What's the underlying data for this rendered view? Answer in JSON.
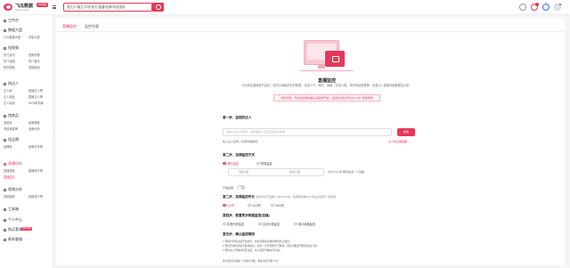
{
  "header": {
    "brand": "飞瓜数据",
    "brand_badge": "抖音版",
    "brand_sub": "FEIGUA DATA",
    "search_placeholder": "搜达人/播主/抖号/宝贝/直播/品牌/商品搜索",
    "icons": [
      "search-icon",
      "app-icon",
      "message-icon",
      "vip-icon",
      "avatar"
    ]
  },
  "sidebar": {
    "items": [
      {
        "label": "工作台",
        "icon": "home-icon"
      },
      {
        "label": "数据大盘",
        "icon": "chart-icon",
        "subs": [
          "行业直播大盘",
          "流量大盘"
        ]
      },
      {
        "label": "找视频",
        "icon": "video-icon",
        "subs": [
          "热门素材",
          "视频热榜",
          "热门话题",
          "热门音乐",
          "带货视频",
          "视频探测"
        ]
      },
      {
        "label": "找达人",
        "icon": "user-icon",
        "subs": [
          "达人库",
          "直播达人榜",
          "达人选品",
          "直播达人榜",
          "达人探测",
          "MCN机构库"
        ]
      },
      {
        "label": "找商品",
        "icon": "bag-icon",
        "subs": [
          "选品库",
          "品牌搜索",
          "商品销量榜",
          "品牌分析"
        ]
      },
      {
        "label": "找品牌",
        "icon": "tag-icon",
        "subs": [
          "品牌库",
          "品牌分析榜"
        ]
      },
      {
        "label": "直播分析",
        "icon": "live-icon",
        "subs": [
          "直播搜索",
          "直播排行榜",
          "直播监控"
        ]
      },
      {
        "label": "视频分析",
        "icon": "play-icon",
        "subs": [
          "视频搜索",
          "视频排行榜"
        ]
      },
      {
        "label": "工具箱",
        "icon": "tool-icon"
      },
      {
        "label": "个人中心",
        "icon": "person-icon"
      },
      {
        "label": "购买套餐",
        "icon": "cart-icon",
        "badge": "限时特惠"
      },
      {
        "label": "联系客服",
        "icon": "service-icon"
      }
    ]
  },
  "tabs": [
    "直播监控",
    "监控列表"
  ],
  "hero": {
    "title": "直播监控",
    "desc": "可对特定直播进行监控，提供分钟级的实时数据，包括人气、曝光、弹幕、在线人数、带货商品数据等；查看达人直播详细数据及分析。",
    "notice": "使用须知：开启监控前请确认直播未开始，监控时长最长可达24小时  查看详情"
  },
  "form": {
    "step1": {
      "title": "第一步、监控的达人",
      "placeholder": "请输入达人抖音号、名称或达人主页链接进行搜索",
      "button": "搜索",
      "hint": "输入达人名称、抖音号等搜索。",
      "hint_right": "达人未直播提醒"
    },
    "step2": {
      "title": "第二步、选择监控方式",
      "options": [
        "预约监控",
        "即刻监控"
      ],
      "start_label": "开始日期",
      "end_label": "结束日期",
      "tip": "共计0.0小时 每天最多一个直播"
    },
    "toggle_label": "开播提醒",
    "step3": {
      "title": "第二步、选择监控时长",
      "note": "监控时长可选择1小时/24小时，监控期间每24小时最多监控一场直播",
      "options": [
        "6小时",
        "12小时",
        "24小时"
      ]
    },
    "step4": {
      "title": "第四步、配置更多数据监控(选填)",
      "options": [
        "礼物分析监控",
        "互动分析监控",
        "观众画像监控"
      ]
    },
    "step5": {
      "title": "第五步、确认监控规则",
      "lines": [
        "1.预约时间到达后开启监控，监控过程中直播中断则停止监控。",
        "2.预约开始时间前可取消监控，监控一旦开始则不可取消；监控次数按开始监控后计算。",
        "3.预约达人开播时间有变更，将以实际开播时间为准。"
      ],
      "quota": "本次监控将消耗 1 次监控次数，剩余监控次数 5 次"
    }
  }
}
